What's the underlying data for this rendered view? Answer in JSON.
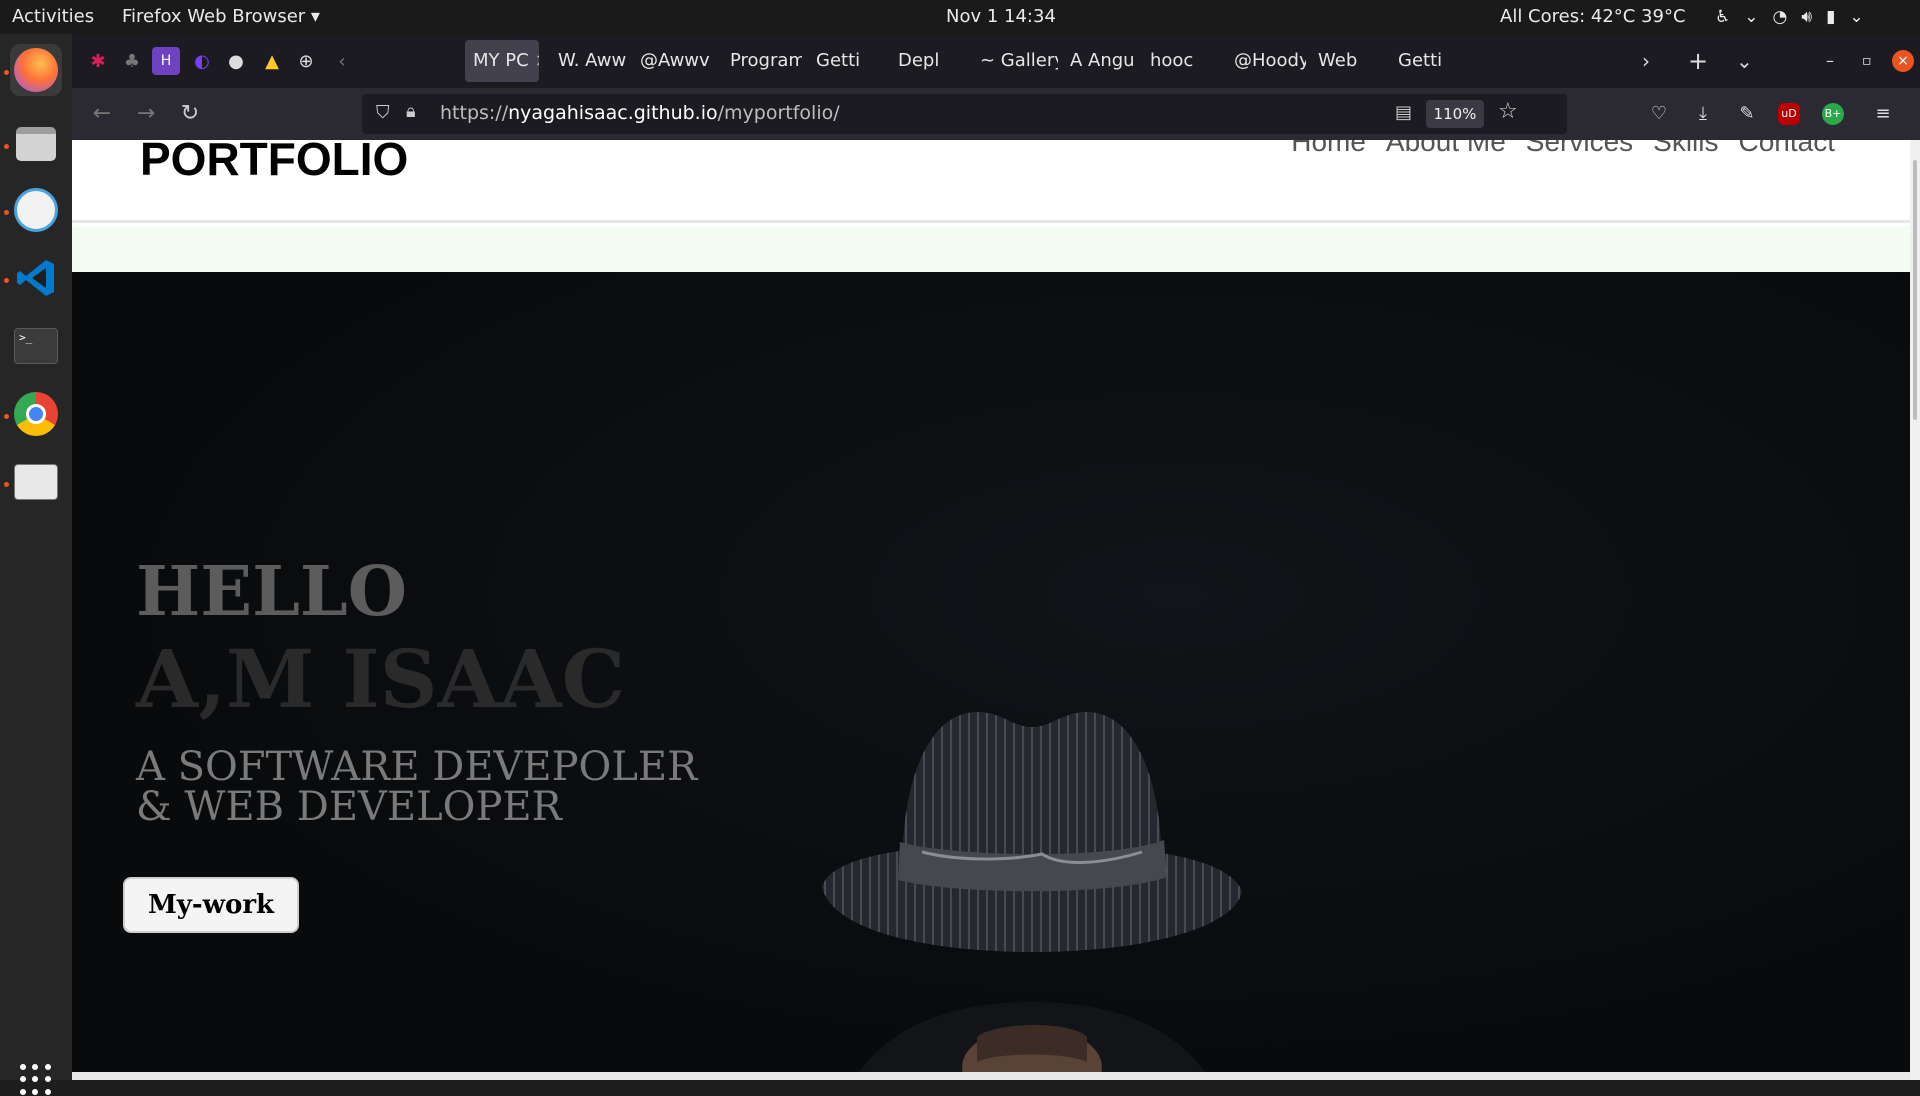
{
  "topbar": {
    "activities": "Activities",
    "app_menu": "Firefox Web Browser ▾",
    "clock": "Nov 1  14:34",
    "sensors": "All Cores: 42°C 39°C"
  },
  "browser": {
    "tabs": [
      {
        "label": "MY PC",
        "active": true
      },
      {
        "label": "W. Aww"
      },
      {
        "label": "@Awwv"
      },
      {
        "label": "Program"
      },
      {
        "label": "Getti"
      },
      {
        "label": "Depl"
      },
      {
        "label": "~ Gallery"
      },
      {
        "label": "A Angu"
      },
      {
        "label": "hooc"
      },
      {
        "label": "@Hoody"
      },
      {
        "label": "Web"
      },
      {
        "label": "Getti"
      }
    ],
    "url": {
      "prefix": "https://",
      "domain": "nyagahisaac.github.io",
      "path": "/myportfolio/"
    },
    "zoom": "110%"
  },
  "site": {
    "logo": "PORTFOLIO",
    "nav": [
      "Home",
      "About Me",
      "Services",
      "Skills",
      "Contact"
    ],
    "hero": {
      "hello": "HELLO",
      "name": "A,M ISAAC",
      "role_line1": "A SOFTWARE DEVEPOLER",
      "role_line2": "& WEB DEVELOPER",
      "button": "My-work"
    }
  },
  "colors": {
    "accent_firefox": "#ff7139",
    "tab_active": "#42414d",
    "hero_bg": "#0b0d10"
  }
}
